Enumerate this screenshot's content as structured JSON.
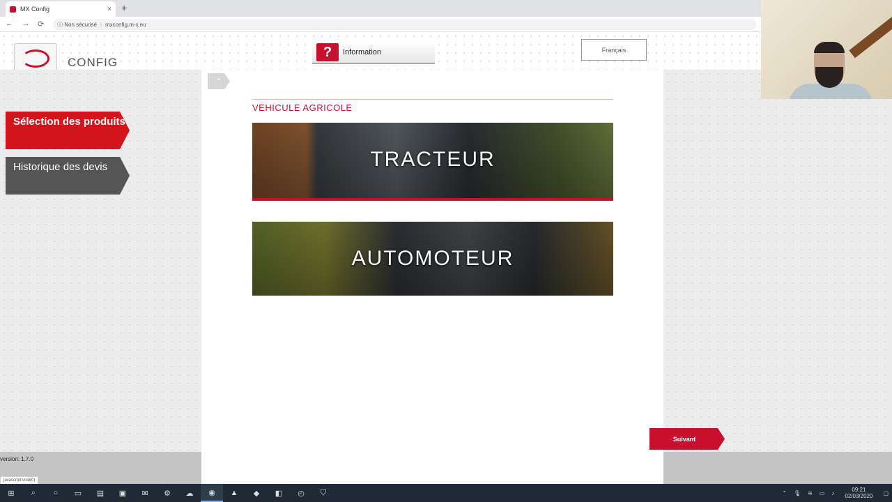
{
  "browser": {
    "tab_title": "MX Config",
    "close_glyph": "×",
    "newtab_glyph": "+",
    "security_label": "Non sécurisé",
    "url": "mxconfig.m-x.eu"
  },
  "header": {
    "logo_text": "MX",
    "app_name": "CONFIG",
    "info_label": "Information",
    "info_icon_glyph": "?",
    "language_label": "Français"
  },
  "sidebar": {
    "items": [
      {
        "label": "Sélection des produits",
        "active": true
      },
      {
        "label": "Historique des devis",
        "active": false
      }
    ],
    "version": "version: 1.7.0",
    "status_url": "javascript:void(0)"
  },
  "main": {
    "up_glyph": "⌃",
    "section_title": "VEHICULE AGRICOLE",
    "banners": [
      {
        "label": "TRACTEUR"
      },
      {
        "label": "AUTOMOTEUR"
      }
    ],
    "next_label": "Suivant"
  },
  "taskbar": {
    "time": "09:21",
    "date": "02/03/2020"
  },
  "colors": {
    "brand_red": "#c8102e",
    "nav_gray": "#555555"
  },
  "icons": [
    "windows-start-icon",
    "search-icon",
    "task-view-icon",
    "chrome-icon",
    "settings-icon"
  ]
}
